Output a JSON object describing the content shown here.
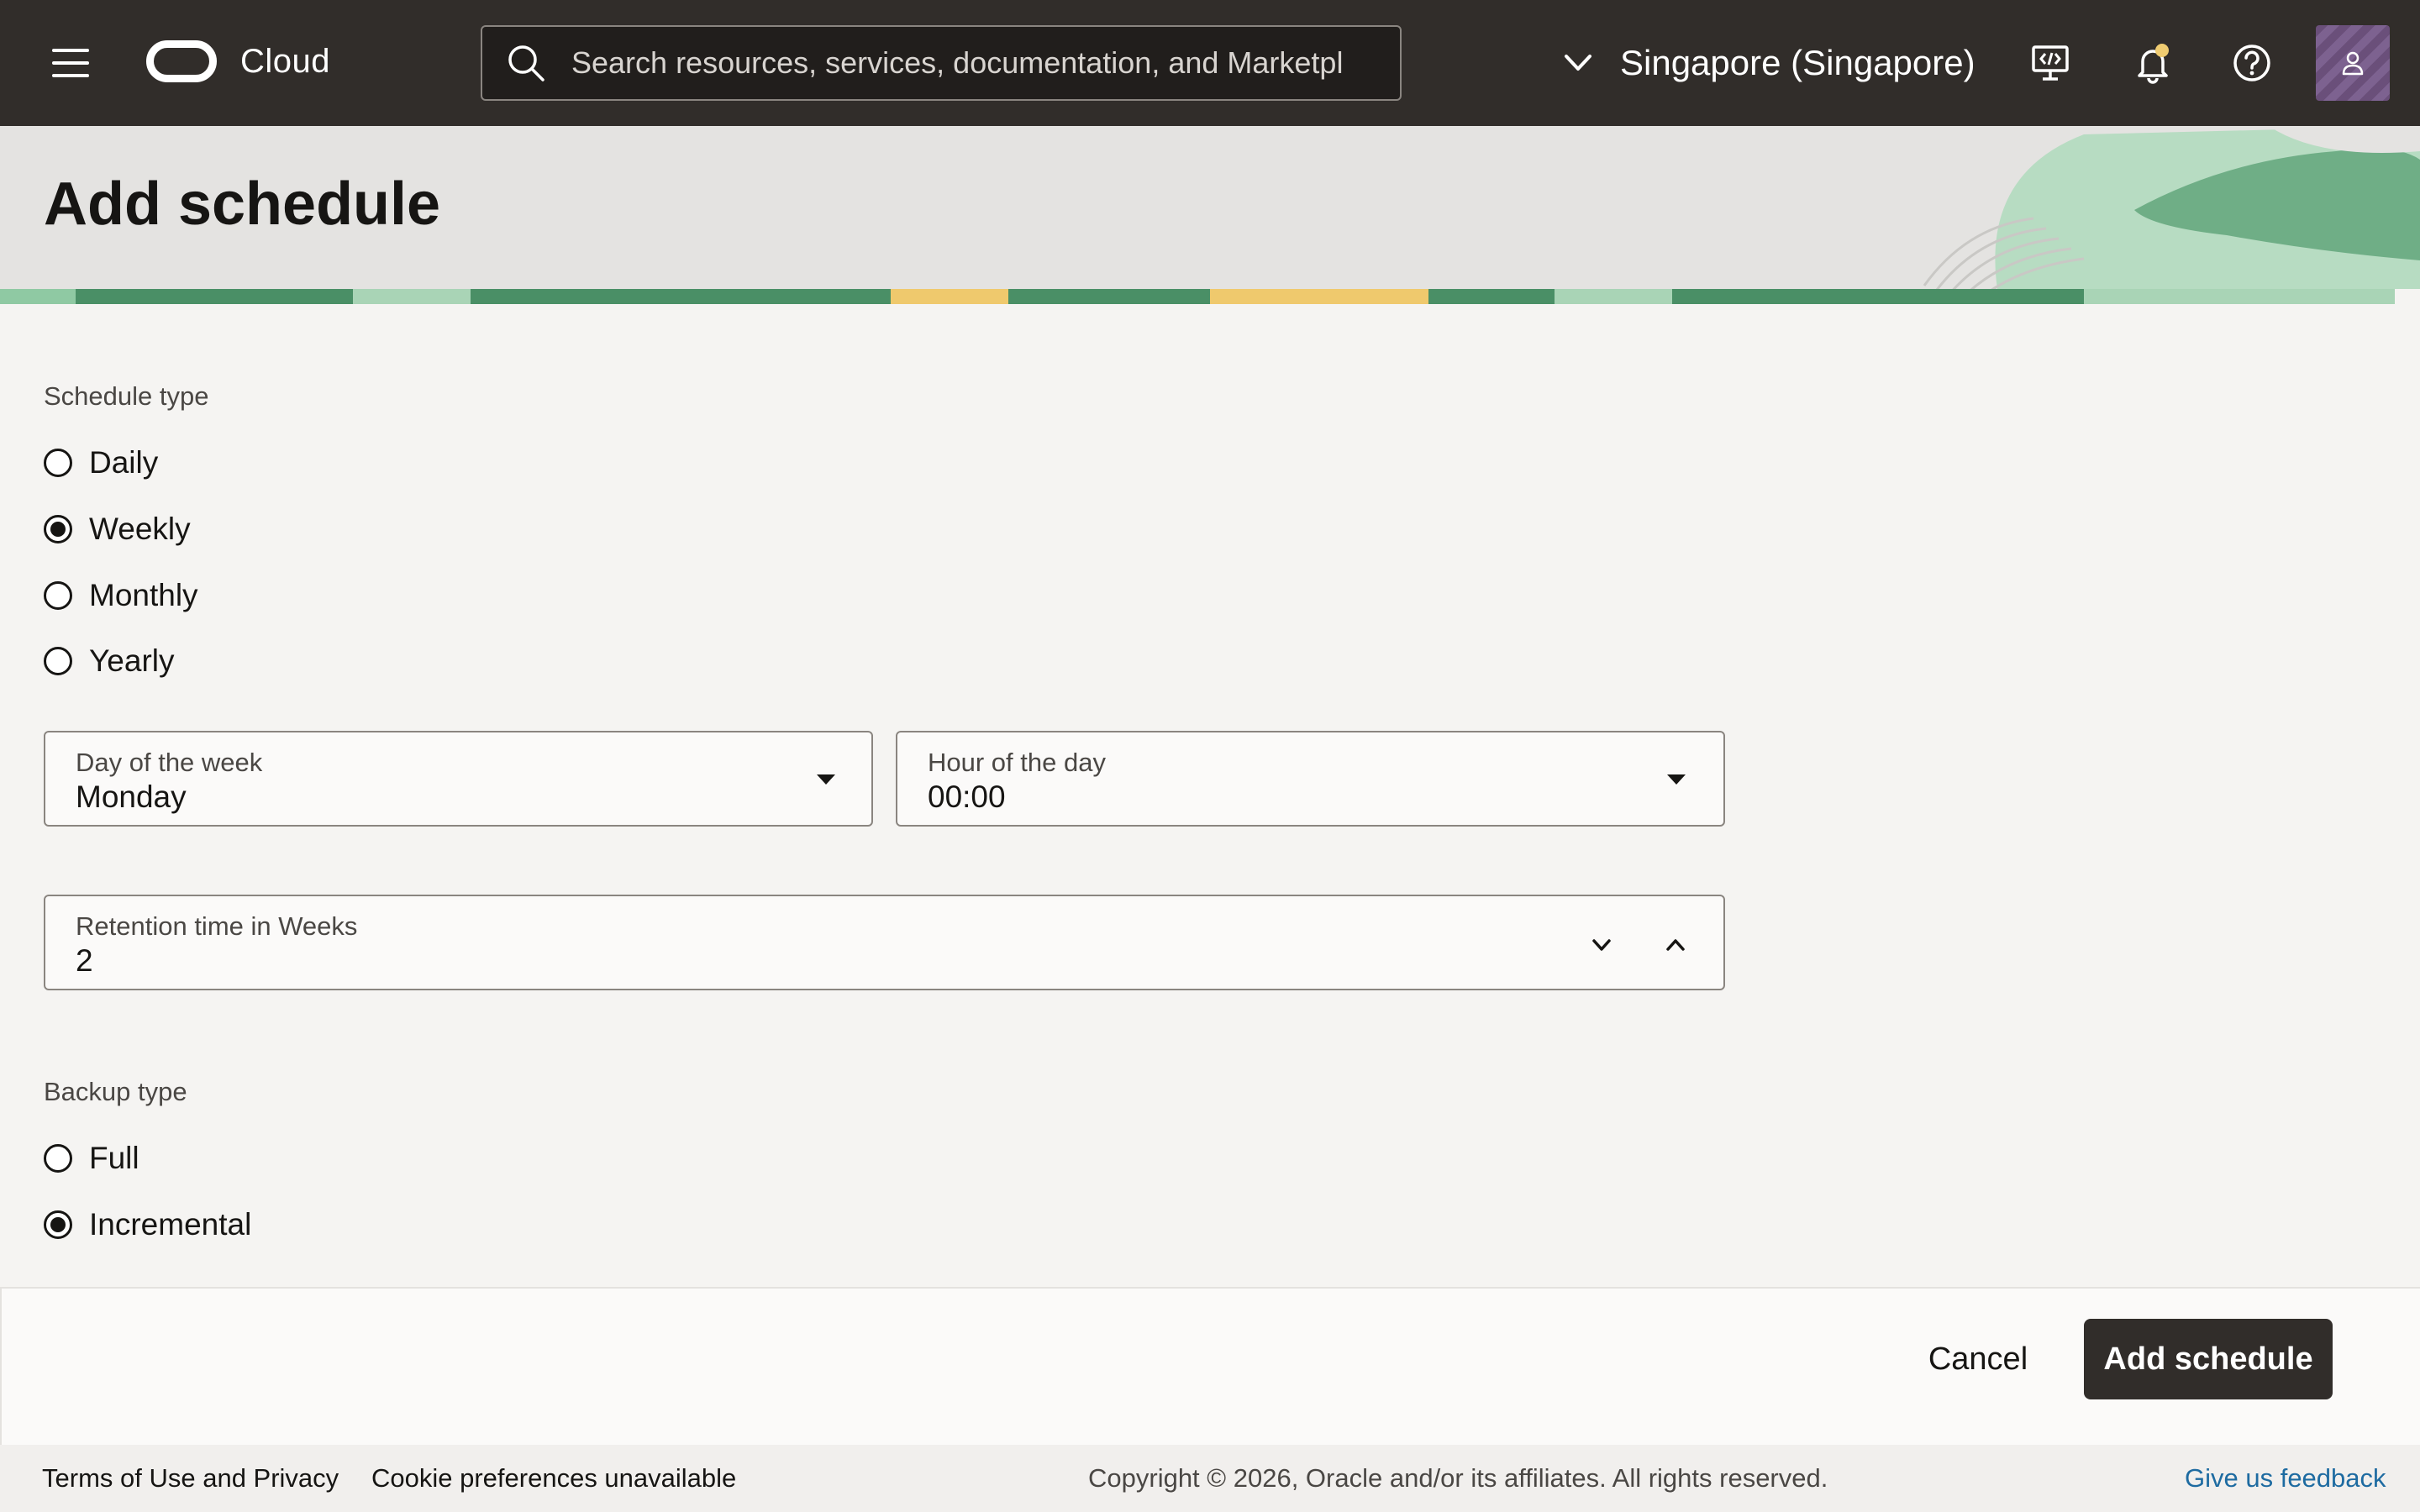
{
  "topbar": {
    "logo_text": "Cloud",
    "search_placeholder": "Search resources, services, documentation, and Marketplace",
    "region": "Singapore (Singapore)"
  },
  "page": {
    "title": "Add schedule"
  },
  "form": {
    "schedule_type": {
      "label": "Schedule type",
      "options": [
        "Daily",
        "Weekly",
        "Monthly",
        "Yearly"
      ],
      "selected": "Weekly"
    },
    "day_of_week": {
      "label": "Day of the week",
      "value": "Monday"
    },
    "hour_of_day": {
      "label": "Hour of the day",
      "value": "00:00"
    },
    "retention": {
      "label": "Retention time in Weeks",
      "value": "2"
    },
    "backup_type": {
      "label": "Backup type",
      "options": [
        "Full",
        "Incremental"
      ],
      "selected": "Incremental"
    }
  },
  "actions": {
    "cancel_label": "Cancel",
    "submit_label": "Add schedule"
  },
  "footer": {
    "terms": "Terms of Use and Privacy",
    "cookies": "Cookie preferences unavailable",
    "copyright": "Copyright © 2026, Oracle and/or its affiliates. All rights reserved.",
    "feedback": "Give us feedback"
  },
  "colors": {
    "topbar": "#312d2a",
    "primary_button": "#312d2a",
    "link": "#1e6ba1",
    "banner_green": "#3f8a5e"
  }
}
